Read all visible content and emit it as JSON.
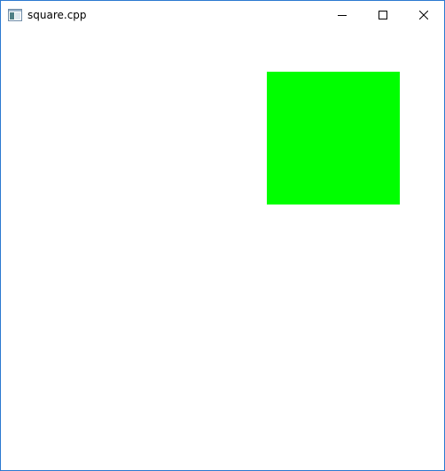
{
  "window": {
    "title": "square.cpp",
    "border_color": "#2b79d0",
    "icon": "app-window-icon",
    "controls": {
      "minimize_icon": "minimize-icon",
      "maximize_icon": "maximize-icon",
      "close_icon": "close-icon"
    }
  },
  "canvas": {
    "background": "#ffffff",
    "square_color": "#00ff00"
  }
}
